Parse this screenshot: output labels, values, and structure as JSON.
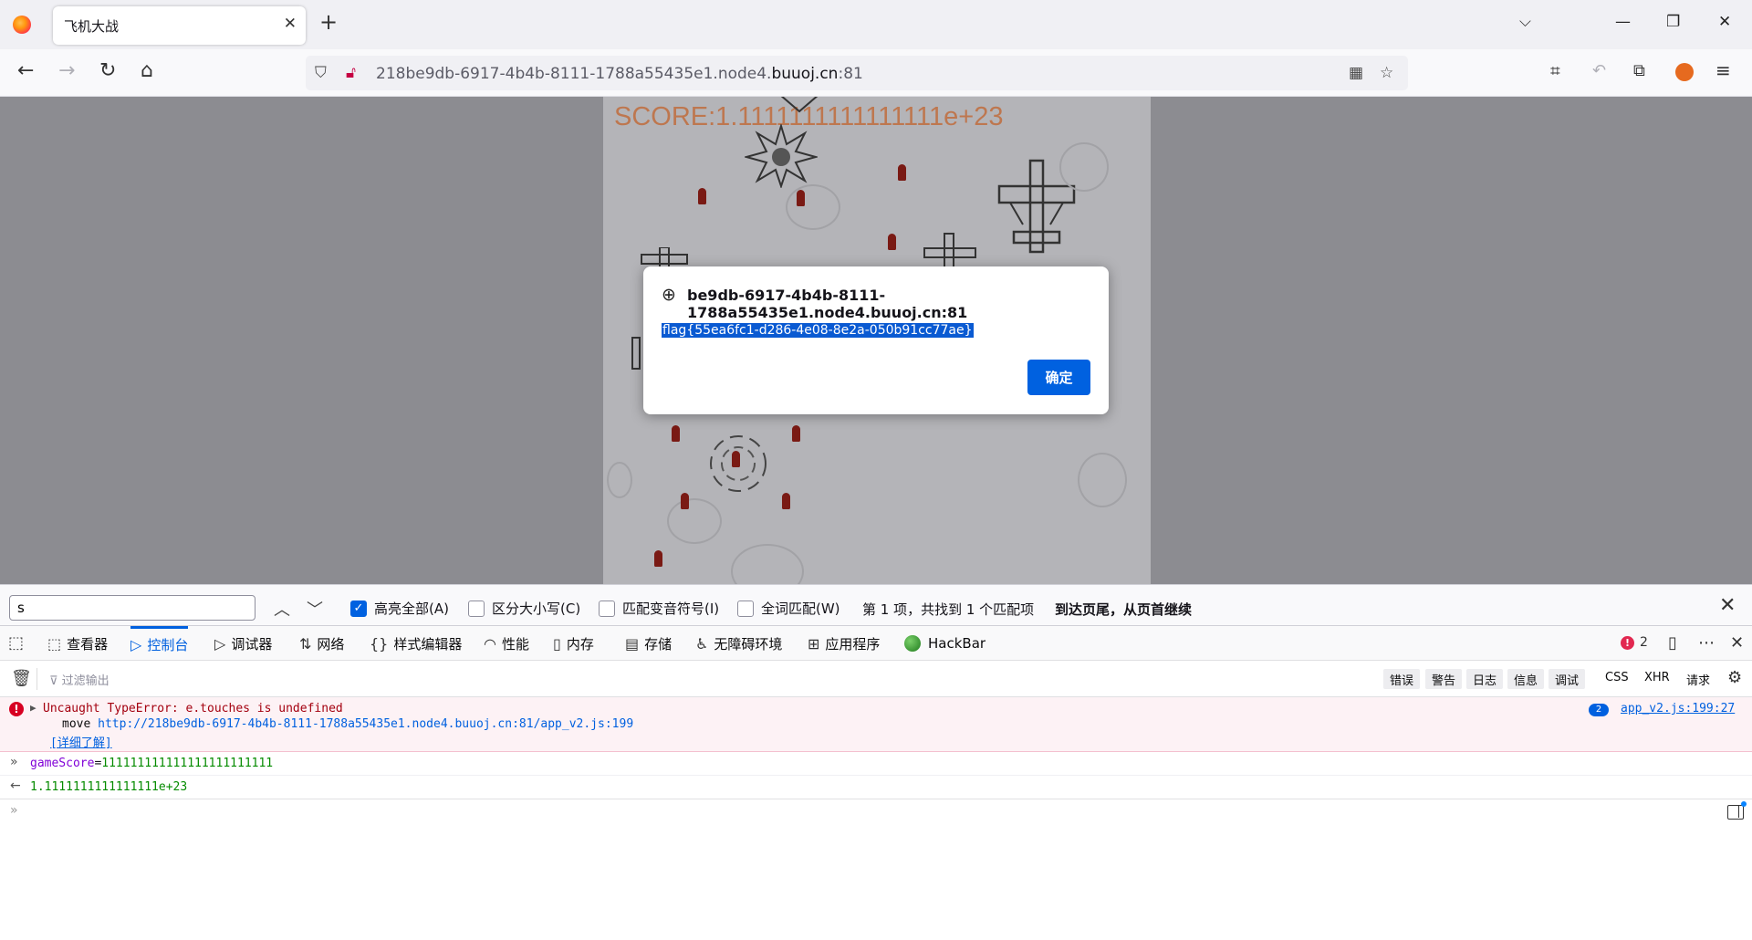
{
  "browser": {
    "tab_title": "飞机大战",
    "url_prefix": "218be9db-6917-4b4b-8111-1788a55435e1.node4.",
    "url_domain": "buuoj.cn",
    "url_port": ":81"
  },
  "game": {
    "score_text": "SCORE:1.1111111111111111e+23"
  },
  "dialog": {
    "origin": "be9db-6917-4b4b-8111-1788a55435e1.node4.buuoj.cn:81",
    "message": "flag{55ea6fc1-d286-4e08-8e2a-050b91cc77ae}",
    "ok_label": "确定"
  },
  "findbar": {
    "query": "s",
    "highlight_all": "高亮全部(A)",
    "match_case": "区分大小写(C)",
    "match_diacritics": "匹配变音符号(I)",
    "whole_words": "全词匹配(W)",
    "status": "第 1 项，共找到 1 个匹配项",
    "wrap_notice": "到达页尾，从页首继续",
    "highlight_all_checked": true
  },
  "devtools": {
    "tabs": [
      "查看器",
      "控制台",
      "调试器",
      "网络",
      "样式编辑器",
      "性能",
      "内存",
      "存储",
      "无障碍环境",
      "应用程序",
      "HackBar"
    ],
    "error_count": "2",
    "filter_placeholder": "过滤输出",
    "levels": [
      "错误",
      "警告",
      "日志",
      "信息",
      "调试"
    ],
    "extra_filters": [
      "CSS",
      "XHR",
      "请求"
    ]
  },
  "console": {
    "error_message": "Uncaught TypeError: e.touches is undefined",
    "error_stack_fn": "move",
    "error_stack_url": "http://218be9db-6917-4b4b-8111-1788a55435e1.node4.buuoj.cn:81/app_v2.js:199",
    "learn_more": "[详细了解]",
    "repeat_count": "2",
    "error_location": "app_v2.js:199:27",
    "command_var": "gameScore",
    "command_eq": "=",
    "command_value": "111111111111111111111111",
    "result": "1.1111111111111111e+23"
  }
}
